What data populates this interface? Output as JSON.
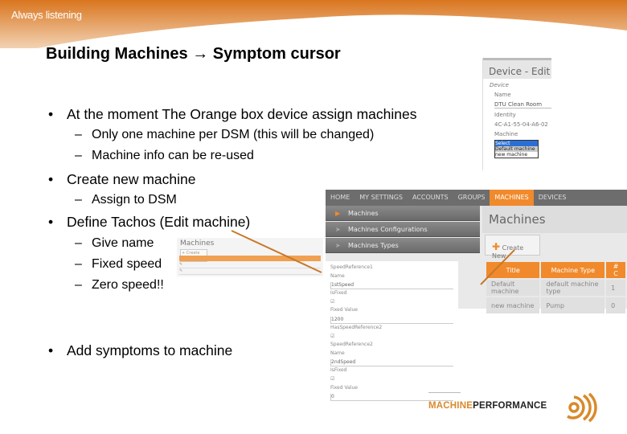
{
  "header": {
    "tagline": "Always listening",
    "accent": "#e07a1f"
  },
  "title": "Building Machines → Symptom cursor",
  "bullets": [
    {
      "text": "At the moment The Orange box device assign machines",
      "sub": [
        "Only one machine per DSM (this will be changed)",
        "Machine info can be re-used"
      ]
    },
    {
      "text": "Create new machine",
      "sub": [
        "Assign to DSM"
      ]
    },
    {
      "text": "Define Tachos (Edit machine)",
      "sub": [
        "Give name",
        "Fixed speed",
        "Zero speed!!"
      ]
    },
    {
      "text": "Add symptoms to machine",
      "sub": []
    }
  ],
  "device_edit": {
    "title": "Device - Edit",
    "section": "Device",
    "name_label": "Name",
    "name_value": "DTU Clean Room",
    "identity_label": "Identity",
    "identity_value": "4C-A1-55-04-A6-02",
    "machine_label": "Machine",
    "options": [
      "Select",
      "Default machine",
      "new machine"
    ]
  },
  "app": {
    "nav": [
      "HOME",
      "MY SETTINGS",
      "ACCOUNTS",
      "GROUPS",
      "MACHINES",
      "DEVICES"
    ],
    "active_nav": "MACHINES",
    "sidebar": [
      "Machines",
      "Machines Configurations",
      "Machines Types"
    ],
    "page_title": "Machines",
    "create_button": "Create New",
    "columns": [
      "Title",
      "Machine Type",
      "# C"
    ],
    "rows": [
      [
        "Default machine",
        "default machine type",
        "1"
      ],
      [
        "new machine",
        "Pump",
        "0"
      ]
    ]
  },
  "form": [
    {
      "k": "label",
      "v": "SpeedReference1"
    },
    {
      "k": "label",
      "v": "Name"
    },
    {
      "k": "input",
      "v": "1stSpeed"
    },
    {
      "k": "label",
      "v": "IsFixed"
    },
    {
      "k": "check",
      "v": "☑"
    },
    {
      "k": "label",
      "v": "Fixed Value"
    },
    {
      "k": "input",
      "v": "1200"
    },
    {
      "k": "label",
      "v": "HasSpeedReference2"
    },
    {
      "k": "check",
      "v": "☑"
    },
    {
      "k": "label",
      "v": "SpeedReference2"
    },
    {
      "k": "label",
      "v": "Name"
    },
    {
      "k": "input",
      "v": "2ndSpeed"
    },
    {
      "k": "label",
      "v": "IsFixed"
    },
    {
      "k": "check",
      "v": "☑"
    },
    {
      "k": "label",
      "v": "Fixed Value"
    },
    {
      "k": "input",
      "v": "0"
    }
  ],
  "small_shot": {
    "title": "Machines",
    "button": "+ Create New"
  },
  "logo": {
    "part1": "MACHINE",
    "part2": "PERFORMANCE"
  }
}
